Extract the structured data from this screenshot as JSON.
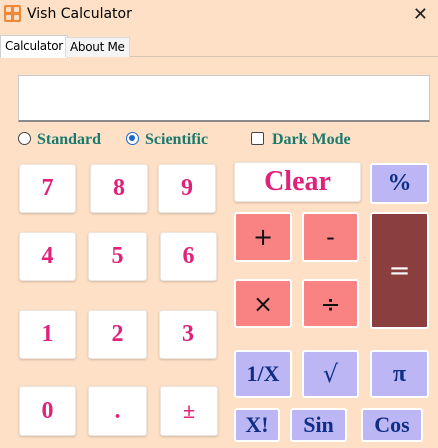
{
  "window": {
    "title": "Vish Calculator",
    "close_glyph": "✕",
    "icon": "calculator-app-icon"
  },
  "tabs": [
    {
      "label": "Calculator",
      "active": true
    },
    {
      "label": "About Me",
      "active": false
    }
  ],
  "display": {
    "value": ""
  },
  "mode": {
    "standard_label": "Standard",
    "scientific_label": "Scientific",
    "selected": "Scientific",
    "dark_mode_label": "Dark Mode",
    "dark_mode_checked": false
  },
  "keys": {
    "seven": "7",
    "eight": "8",
    "nine": "9",
    "four": "4",
    "five": "5",
    "six": "6",
    "one": "1",
    "two": "2",
    "three": "3",
    "zero": "0",
    "dot": ".",
    "plusminus": "±",
    "clear": "Clear",
    "percent": "%",
    "plus": "+",
    "minus": "-",
    "multiply": "×",
    "divide": "÷",
    "equals": "=",
    "reciprocal": "1/X",
    "sqrt": "√",
    "pi": "π",
    "factorial": "X!",
    "sin": "Sin",
    "cos": "Cos"
  },
  "colors": {
    "background": "#fde0c6",
    "digit_text": "#e0227a",
    "scientific_key": "#bdb6f5",
    "scientific_text": "#0f2f86",
    "operator_key": "#f88382",
    "equals_key": "#8a3e3e",
    "mode_text": "#1a7a6e"
  }
}
